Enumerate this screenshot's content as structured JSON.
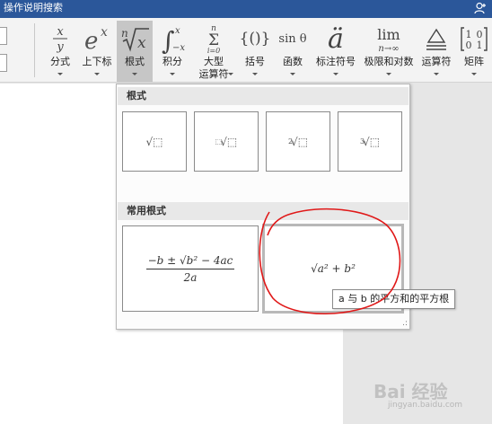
{
  "window": {
    "title": "操作说明搜索"
  },
  "ribbon": {
    "tools": [
      {
        "id": "fraction",
        "label": "分式",
        "glyph": "x/y"
      },
      {
        "id": "script",
        "label": "上下标",
        "glyph": "eˣ"
      },
      {
        "id": "radical",
        "label": "根式",
        "glyph": "ⁿ√x",
        "active": true
      },
      {
        "id": "integral",
        "label": "积分",
        "glyph": "∫"
      },
      {
        "id": "large-operator",
        "label": "大型",
        "label2": "运算符",
        "glyph": "Σ"
      },
      {
        "id": "bracket",
        "label": "括号",
        "glyph": "{()}"
      },
      {
        "id": "function",
        "label": "函数",
        "glyph": "sin θ"
      },
      {
        "id": "accent",
        "label": "标注符号",
        "glyph": "ä"
      },
      {
        "id": "limit-log",
        "label": "极限和对数",
        "glyph": "lim"
      },
      {
        "id": "operator",
        "label": "运算符",
        "glyph": "≜"
      },
      {
        "id": "matrix",
        "label": "矩阵",
        "glyph": "[10 01]"
      }
    ],
    "glyph_extra": {
      "integral_top": "x",
      "integral_bottom": "−x",
      "sum_top": "n",
      "sum_bottom": "i=0",
      "lim_sub": "n→∞"
    }
  },
  "gallery": {
    "sections": [
      {
        "title": "根式"
      },
      {
        "title": "常用根式"
      }
    ],
    "radicals": [
      {
        "name": "square-root",
        "symbol": "√⬚"
      },
      {
        "name": "square-root-with-degree",
        "index": "⬚",
        "symbol": "√⬚"
      },
      {
        "name": "square-root-degree-2",
        "index": "2",
        "symbol": "√⬚"
      },
      {
        "name": "cube-root",
        "index": "3",
        "symbol": "√⬚"
      }
    ],
    "common": [
      {
        "name": "quadratic-formula",
        "numerator": "−b ± √b² − 4ac",
        "denominator": "2a"
      },
      {
        "name": "pythagorean-root",
        "formula": "√a² + b²"
      }
    ],
    "tooltip": "a 与 b 的平方和的平方根"
  },
  "watermark": {
    "text": "Bai 经验",
    "sub": "jingyan.baidu.com"
  }
}
